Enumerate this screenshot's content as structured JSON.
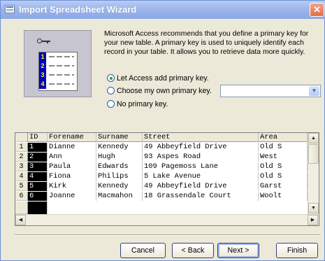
{
  "window": {
    "title": "Import Spreadsheet Wizard",
    "close_glyph": "✕",
    "icons": [
      "wizard-app-icon",
      "close-icon"
    ]
  },
  "illustration": {
    "key_icon": "key-icon",
    "rows": [
      "1",
      "2",
      "3",
      "4"
    ]
  },
  "description": "Microsoft Access recommends that you define a primary key for your new table. A primary key is used to uniquely identify each record in your table. It allows you to retrieve data more quickly.",
  "options": [
    {
      "label": "Let Access add primary key.",
      "selected": true
    },
    {
      "label": "Choose my own primary key.",
      "selected": false
    },
    {
      "label": "No primary key.",
      "selected": false
    }
  ],
  "primary_key_combo": {
    "value": "",
    "arrow_glyph": "▼"
  },
  "grid": {
    "columns": [
      "ID",
      "Forename",
      "Surname",
      "Street",
      "Area"
    ],
    "row_numbers": [
      "1",
      "2",
      "3",
      "4",
      "5",
      "6"
    ],
    "rows": [
      [
        "1",
        "Dianne",
        "Kennedy",
        "49 Abbeyfield Drive",
        "Old S"
      ],
      [
        "2",
        "Ann",
        "Hugh",
        "93 Aspes Road",
        "West"
      ],
      [
        "3",
        "Paula",
        "Edwards",
        "109 Pagemoss Lane",
        "Old S"
      ],
      [
        "4",
        "Fiona",
        "Philips",
        "5 Lake Avenue",
        "Old S"
      ],
      [
        "5",
        "Kirk",
        "Kennedy",
        "49 Abbeyfield Drive",
        "Garst"
      ],
      [
        "6",
        "Joanne",
        "Macmahon",
        "18 Grassendale Court",
        "Woolt"
      ]
    ]
  },
  "scrollbars": {
    "up": "▲",
    "down": "▼",
    "left": "◀",
    "right": "▶"
  },
  "buttons": {
    "cancel": "Cancel",
    "back": "< Back",
    "next": "Next >",
    "finish": "Finish"
  },
  "colors": {
    "accent": "#2a5bb8",
    "selected_column_bg": "#000000",
    "key_row_bg": "#0000c0"
  }
}
